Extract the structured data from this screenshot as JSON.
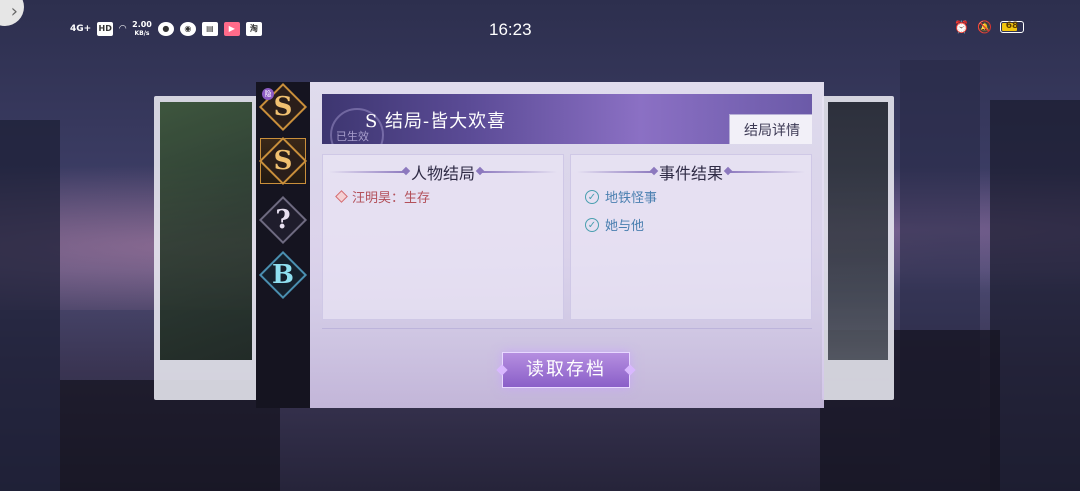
{
  "status_bar": {
    "network": "4G+",
    "speed": "2.00",
    "speed_unit": "KB/s",
    "time": "16:23",
    "battery": "68"
  },
  "tabs": [
    {
      "letter": "S",
      "color": "#f0c070",
      "badge": "隐"
    },
    {
      "letter": "S",
      "color": "#f0c070",
      "active": true
    },
    {
      "letter": "?",
      "color": "#e8e0f0"
    },
    {
      "letter": "B",
      "color": "#8fe0f0"
    }
  ],
  "ending": {
    "title": "S 结局-皆大欢喜",
    "stamp": "已生效",
    "detail_button": "结局详情"
  },
  "characters": {
    "heading": "人物结局",
    "items": [
      "汪明昊：生存"
    ]
  },
  "events": {
    "heading": "事件结果",
    "items": [
      "地铁怪事",
      "她与他"
    ]
  },
  "load_button": "读取存档",
  "colors": {
    "accent": "#8a5fc8",
    "gold": "#c98f3b",
    "text_character": "#b3505a",
    "text_event": "#4a7fb0"
  }
}
